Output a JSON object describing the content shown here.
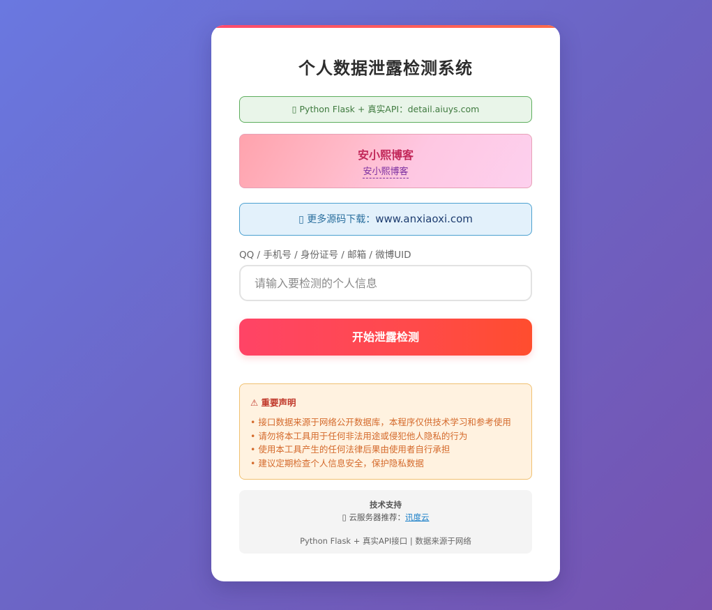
{
  "header": {
    "title": "个人数据泄露检测系统"
  },
  "api_notice": {
    "icon": "box-icon",
    "text": "▯ Python Flask + 真实API：detail.aiuys.com"
  },
  "blog": {
    "title": "安小熙博客",
    "link": "安小熙博客"
  },
  "source": {
    "prefix": "▯ 更多源码下载：",
    "site": "www.anxiaoxi.com"
  },
  "form": {
    "label": "QQ / 手机号 / 身份证号 / 邮箱 / 微博UID",
    "placeholder": "请输入要检测的个人信息",
    "value": "",
    "submit_label": "开始泄露检测"
  },
  "disclaimer": {
    "title": "⚠ 重要声明",
    "items": [
      "• 接口数据来源于网络公开数据库，本程序仅供技术学习和参考使用",
      "• 请勿将本工具用于任何非法用途或侵犯他人隐私的行为",
      "• 使用本工具产生的任何法律后果由使用者自行承担",
      "• 建议定期检查个人信息安全，保护隐私数据"
    ]
  },
  "footer": {
    "title": "技术支持",
    "recommend_prefix": "▯ 云服务器推荐：",
    "recommend_link": "讯度云",
    "bottom": "Python Flask + 真实API接口 | 数据来源于网络"
  },
  "colors": {
    "background_start": "#6a78e0",
    "background_end": "#7652b0",
    "button_start": "#ff4466",
    "button_end": "#ff4d2e"
  }
}
